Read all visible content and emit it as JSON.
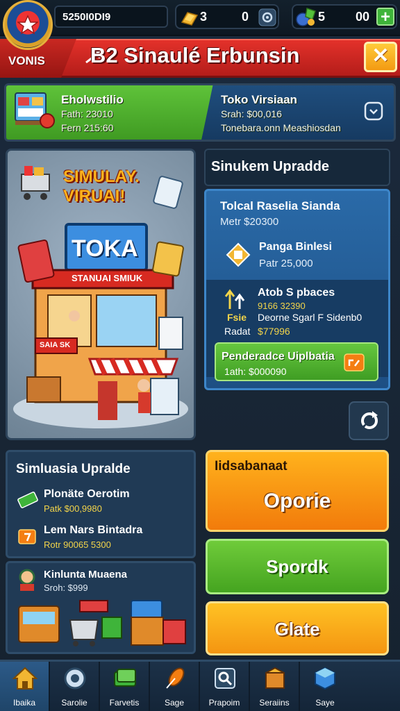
{
  "topbar": {
    "coins": "5250I0DI9",
    "resource1_value": "3",
    "resource1_count": "0",
    "resource2_value": "5",
    "resource2_count": "00",
    "plus_label": "+"
  },
  "banner": {
    "left_label": "VONIS",
    "title": "B2 Sinaulé Erbunsin",
    "close_label": "✕"
  },
  "info_strip": {
    "left": {
      "title": "Eholwstilio",
      "line1": "Fath: 23010",
      "line2": "Fern 215:60"
    },
    "right": {
      "title": "Toko Virsiaan",
      "line1": "Srah: $00,016",
      "line2": "Tonebara.onn Meashiosdan"
    }
  },
  "shop_card": {
    "headline1": "SIMULAY.",
    "headline2": "VIRUAI!",
    "store_sign": "TOKA",
    "store_banner": "STANUAI SMIUK",
    "store_panel": "SAIA SK"
  },
  "upgrade_panel": {
    "header": "Sinukem Upradde",
    "main_title": "Tolcal Raselia Sianda",
    "main_sub": "Metr $20300",
    "item1_title": "Panga Binlesi",
    "item1_sub": "Patr 25,000",
    "item2_title": "Atob S pbaces",
    "item2_sub1": "9166 32390",
    "item2_sub2": "Deorne Sgarl F Sidenb0",
    "item2_label": "Radat",
    "item2_price": "$77996",
    "item2_side": "Fsie",
    "button_title": "Penderadce Uiplbatia",
    "button_sub": "1ath: $000090"
  },
  "left_upgrades": {
    "title": "Simluasia Upralde",
    "item1_title": "Plonäte Oerotim",
    "item1_sub": "Patk $00,9980",
    "item2_title": "Lem Nars Bintadra",
    "item2_sub": "Rotr 90065 5300"
  },
  "mini_card": {
    "title": "Kinlunta Muaena",
    "sub": "Sroh: $999"
  },
  "actions": {
    "top_label": "Iidsabanaat",
    "top_button": "Oporie",
    "green_button": "Spordk",
    "orange_button": "Glate"
  },
  "nav": [
    {
      "label": "Ibaika",
      "icon": "home-icon"
    },
    {
      "label": "Sarolie",
      "icon": "coin-icon"
    },
    {
      "label": "Farvetis",
      "icon": "money-icon"
    },
    {
      "label": "Sage",
      "icon": "feather-icon"
    },
    {
      "label": "Prapoim",
      "icon": "search-icon"
    },
    {
      "label": "Seraiins",
      "icon": "box-icon"
    },
    {
      "label": "Saye",
      "icon": "cube-icon"
    }
  ],
  "colors": {
    "banner_red": "#e3312a",
    "accent_green": "#5fc33a",
    "accent_orange": "#f7931a",
    "panel_blue": "#2a6aa8"
  }
}
